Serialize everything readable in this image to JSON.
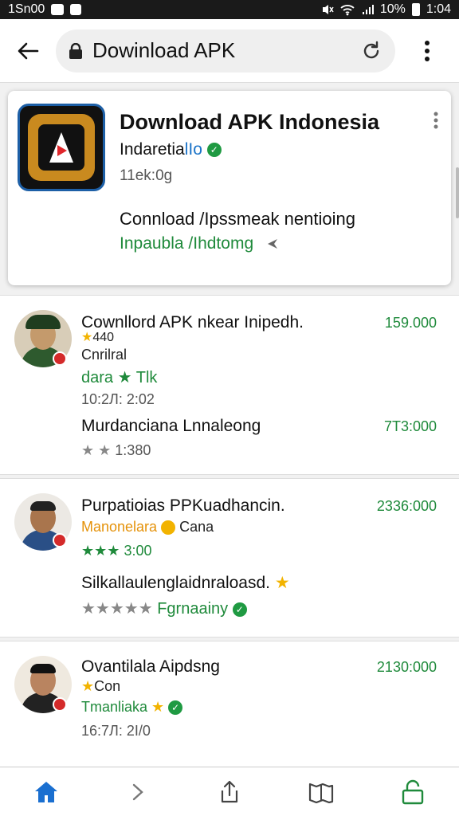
{
  "status_bar": {
    "left_text": "1Sn00",
    "battery": "10%",
    "time": "1:04"
  },
  "toolbar": {
    "url_text": "Dowinload APK"
  },
  "featured": {
    "title": "Download APK Indonesia",
    "subtitle_prefix": "Indaretia",
    "subtitle_highlight": "lIo",
    "meta": "11ek:0g",
    "description": "Connload /Ipssmeak nentioing",
    "link_text": "Inpaubla /Ihdtomg"
  },
  "items": [
    {
      "title": "Cownllord APK nkear Inipedh.",
      "price": "159.000",
      "rating_num": "440",
      "category": "Cnrilral",
      "tag": "dara",
      "tag2": "Tlk",
      "time": "10:2Л: 2:02",
      "desc": "Murdanciana Lnnaleong",
      "desc_price": "7Т3:000",
      "rating_count": "1:380"
    },
    {
      "title": "Purpatioias PPKuadhancin.",
      "price": "2336:000",
      "dev_name": "Manonelara",
      "dev_tag": "Cana",
      "rating_value": "3:00",
      "desc": "Silkallaulenglaidnraloasd.",
      "verified_text": "Fgrnaainy"
    },
    {
      "title": "Ovantilala Aipdsng",
      "price": "2130:000",
      "rating_text": "Con",
      "dev_name": "Tmanliaka",
      "time": "16:7Л: 2І/0"
    }
  ]
}
